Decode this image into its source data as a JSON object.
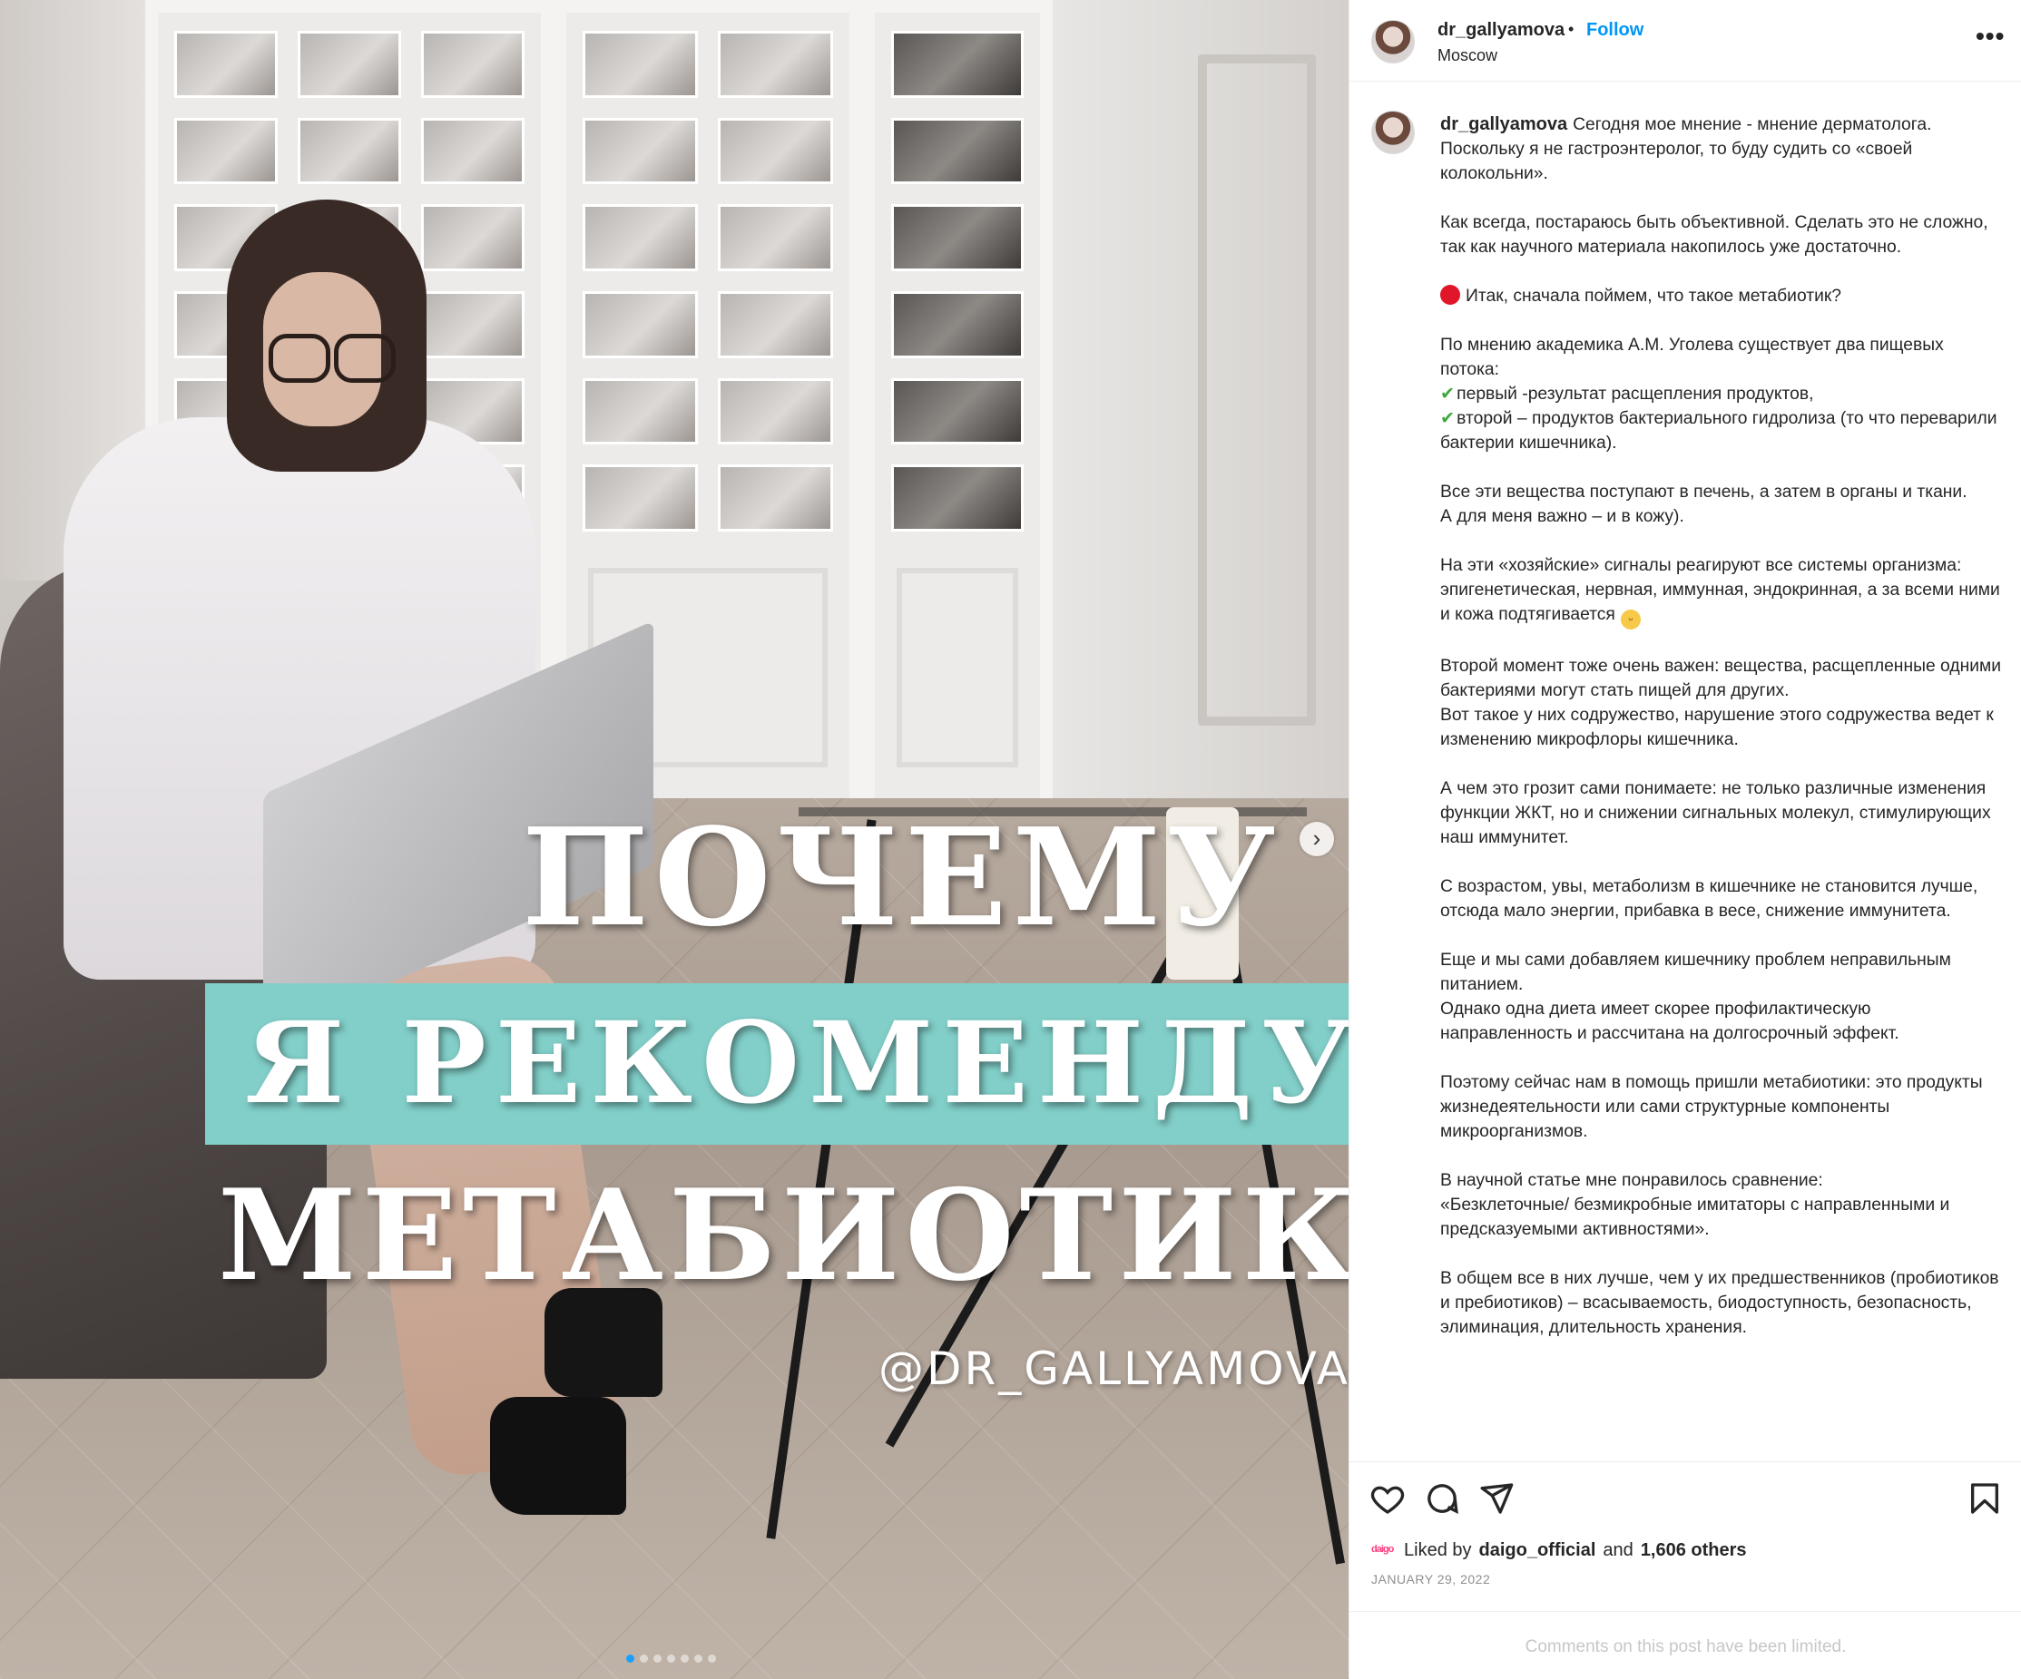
{
  "post": {
    "username": "dr_gallyamova",
    "follow_label": "Follow",
    "separator": "•",
    "location": "Moscow",
    "more_icon": "more-horizontal-icon"
  },
  "media": {
    "overlay_line1": "ПОЧЕМУ",
    "overlay_line2": "Я РЕКОМЕНДУЮ",
    "overlay_line3": "МЕТАБИОТИК?",
    "handle": "@DR_GALLYAMOVA",
    "next_arrow": "›",
    "carousel_slide_count": 7,
    "carousel_active_index": 0,
    "accent_teal": "#82cfc9"
  },
  "caption": {
    "username": "dr_gallyamova",
    "p1": "Сегодня мое мнение - мнение дерматолога. Поскольку я не гастроэнтеролог, то буду судить со «своей колокольни».",
    "p2": "Как всегда, постараюсь быть объективной. Сделать это не сложно, так как научного материала накопилось уже достаточно.",
    "p3": "Итак, сначала поймем, что такое метабиотик?",
    "p4_intro": "По мнению академика А.М. Уголева существует два пищевых потока:",
    "p4_item1": "первый -результат расщепления продуктов,",
    "p4_item2": "второй – продуктов бактериального гидролиза (то что переварили бактерии кишечника).",
    "p5_line1": "Все эти вещества поступают в печень, а затем в органы и ткани.",
    "p5_line2": "А для меня важно – и в кожу).",
    "p6": "На эти «хозяйские» сигналы реагируют все системы организма: эпигенетическая, нервная, иммунная, эндокринная, а за всеми ними и кожа подтягивается",
    "p7_line1": "Второй момент тоже очень важен: вещества, расщепленные одними бактериями могут стать пищей для других.",
    "p7_line2": "Вот такое у них содружество, нарушение этого содружества ведет к изменению микрофлоры кишечника.",
    "p8": "А чем это грозит сами понимаете: не только различные изменения функции ЖКТ, но и снижении сигнальных молекул, стимулирующих наш иммунитет.",
    "p9": "С возрастом, увы, метаболизм в кишечнике не становится лучше, отсюда мало энергии, прибавка в весе, снижение иммунитета.",
    "p10_line1": "Еще и мы сами добавляем кишечнику проблем неправильным питанием.",
    "p10_line2": "Однако одна диета имеет скорее профилактическую направленность и рассчитана на долгосрочный эффект.",
    "p11": "Поэтому сейчас нам в помощь пришли метабиотики: это продукты жизнедеятельности или сами структурные компоненты микроорганизмов.",
    "p12_line1": "В научной статье мне понравилось сравнение:",
    "p12_line2": "«Безклеточные/ безмикробные имитаторы с направленными и предсказуемыми активностями».",
    "p13": "В общем все в них лучше, чем у их предшественников (пробиотиков и пребиотиков) – всасываемость, биодоступность, безопасность, элиминация, длительность хранения."
  },
  "actions": {
    "like_icon": "heart-icon",
    "comment_icon": "comment-icon",
    "share_icon": "paper-plane-icon",
    "save_icon": "bookmark-icon"
  },
  "likes": {
    "logo_text": "daigo",
    "prefix": "Liked by",
    "liker": "daigo_official",
    "joiner": "and",
    "others": "1,606 others"
  },
  "date": "JANUARY 29, 2022",
  "comments_limited": "Comments on this post have been limited.",
  "colors": {
    "link_blue": "#0095f6",
    "text": "#262626",
    "muted": "#8e8e8e",
    "red_circle": "#e0162b",
    "check_green": "#3ea73e"
  }
}
